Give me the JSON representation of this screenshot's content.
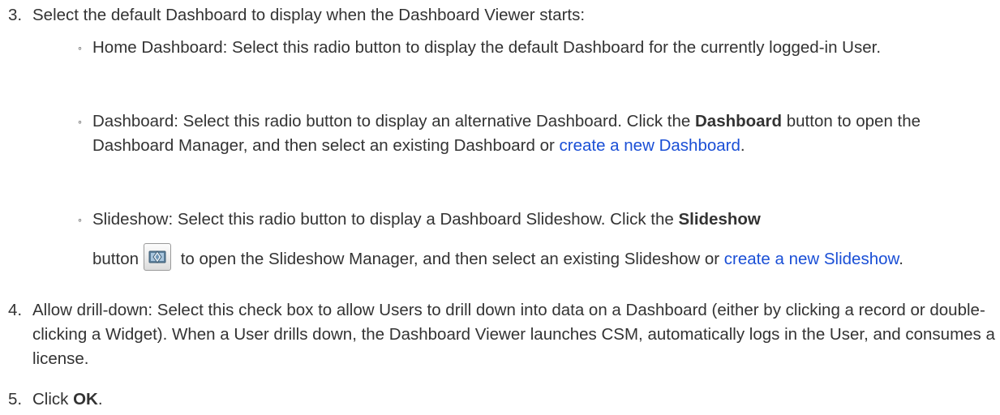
{
  "step3": {
    "number": "3.",
    "intro": "Select the default Dashboard to display when the Dashboard Viewer starts:",
    "options": [
      {
        "text": "Home Dashboard: Select this radio button to display the default Dashboard for the currently logged-in User."
      },
      {
        "text_before": "Dashboard: Select this radio button to display an alternative Dashboard. Click the ",
        "bold": "Dashboard",
        "text_after": " button to open the Dashboard Manager, and then select an existing Dashboard or ",
        "link": "create a new Dashboard",
        "end": "."
      },
      {
        "text_before": "Slideshow: Select this radio button to display a Dashboard Slideshow. Click the ",
        "bold": "Slideshow",
        "text_button": "button",
        "text_after": " to open the Slideshow Manager, and then select an existing Slideshow or ",
        "link": "create a new Slideshow",
        "end": ".",
        "icon": "slideshow-icon"
      }
    ]
  },
  "step4": {
    "number": "4.",
    "text": "Allow drill-down: Select this check box to allow Users to drill down into data on a Dashboard (either by clicking a record or double-clicking a Widget). When a User drills down, the Dashboard Viewer launches CSM, automatically logs in the User, and consumes a license."
  },
  "step5": {
    "number": "5.",
    "text_before": "Click ",
    "bold": "OK",
    "end": "."
  },
  "colors": {
    "text": "#333333",
    "link": "#1a4fd6"
  }
}
